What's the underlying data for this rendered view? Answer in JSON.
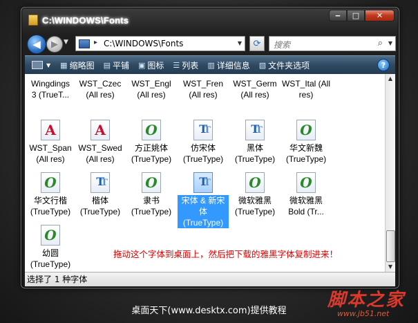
{
  "window": {
    "title": "C:\\WINDOWS\\Fonts"
  },
  "address": {
    "path": "C:\\WINDOWS\\Fonts",
    "crumb_separator": "▸",
    "search_placeholder": "搜索"
  },
  "toolbar": {
    "items": [
      {
        "label": "缩略图",
        "icon": "thumbnails-icon"
      },
      {
        "label": "平铺",
        "icon": "tiles-icon"
      },
      {
        "label": "图标",
        "icon": "icons-icon"
      },
      {
        "label": "列表",
        "icon": "list-icon"
      },
      {
        "label": "详细信息",
        "icon": "details-icon"
      },
      {
        "label": "文件夹选项",
        "icon": "folder-options-icon"
      }
    ]
  },
  "fonts": [
    {
      "label": "Wingdings\n3 (TrueT...",
      "type": "o"
    },
    {
      "label": "WST_Czec\n(All res)",
      "type": "a"
    },
    {
      "label": "WST_Engl\n(All res)",
      "type": "a"
    },
    {
      "label": "WST_Fren\n(All res)",
      "type": "a"
    },
    {
      "label": "WST_Germ\n(All res)",
      "type": "a"
    },
    {
      "label": "WST_Ital (All\nres)",
      "type": "a"
    },
    {
      "label": "WST_Span\n(All res)",
      "type": "a"
    },
    {
      "label": "WST_Swed\n(All res)",
      "type": "a"
    },
    {
      "label": "方正姚体\n(TrueType)",
      "type": "o"
    },
    {
      "label": "仿宋体\n(TrueType)",
      "type": "t"
    },
    {
      "label": "黑体\n(TrueType)",
      "type": "t"
    },
    {
      "label": "华文新魏\n(TrueType)",
      "type": "o"
    },
    {
      "label": "华文行楷\n(TrueType)",
      "type": "o"
    },
    {
      "label": "楷体\n(TrueType)",
      "type": "t"
    },
    {
      "label": "隶书\n(TrueType)",
      "type": "o"
    },
    {
      "label": "宋体 & 新宋\n体\n(TrueType)",
      "type": "t",
      "selected": true
    },
    {
      "label": "微软雅黑\n(TrueType)",
      "type": "o"
    },
    {
      "label": "微软雅黑\nBold (Tr...",
      "type": "o"
    },
    {
      "label": "幼圆\n(TrueType)",
      "type": "o"
    }
  ],
  "instruction": "拖动这个字体到桌面上，然后把下载的雅黑字体复制进来！",
  "status": {
    "text": "选择了 1 种字体"
  },
  "caption": "桌面天下(www.desktx.com)提供教程",
  "watermark": {
    "title": "脚本之家",
    "url": "www.jb51.net"
  },
  "colors": {
    "selection": "#3399ff",
    "instruction": "#e00000",
    "toolbar": "#2f4a63",
    "close_button": "#c0391d"
  }
}
